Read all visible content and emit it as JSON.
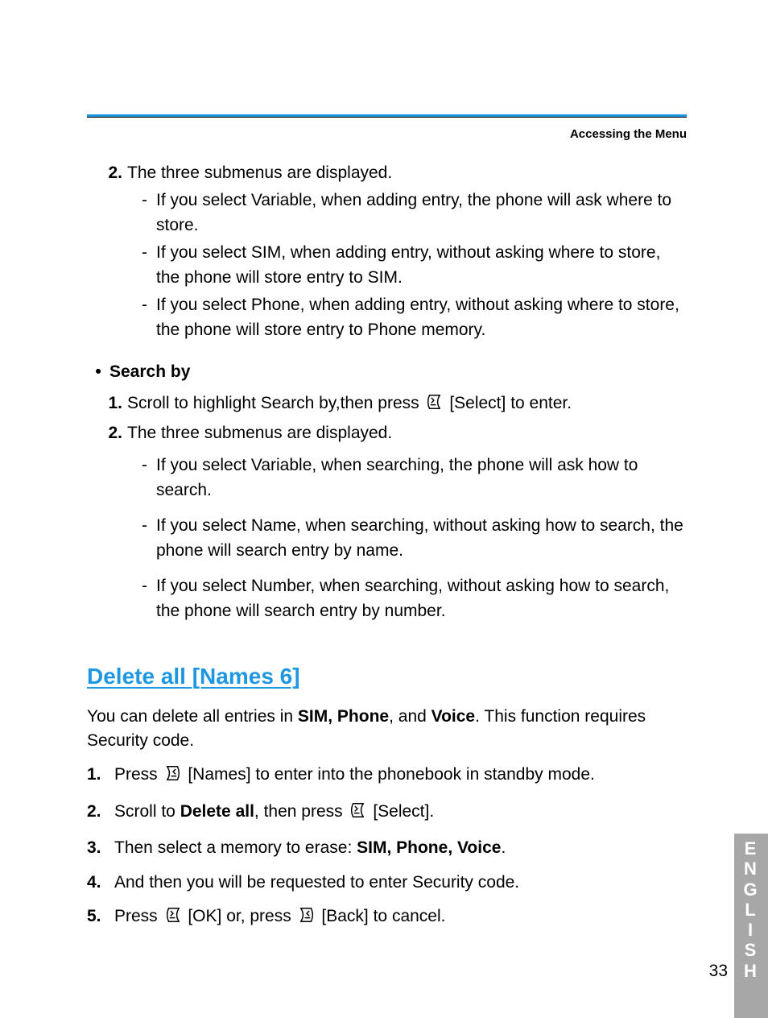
{
  "header": {
    "section": "Accessing the Menu"
  },
  "top": {
    "item2_num": "2.",
    "item2_text": "The three submenus are displayed.",
    "bullets": [
      "If you select Variable, when adding entry, the phone will ask where to store.",
      "If you select SIM, when adding entry, without asking where to store, the phone will store entry to SIM.",
      "If you select Phone, when adding entry, without asking where to store, the phone will store entry to Phone memory."
    ]
  },
  "search": {
    "title": "Search by",
    "step1_num": "1.",
    "step1_pre": "Scroll to highlight Search by,then press ",
    "step1_post": " [Select] to enter.",
    "step2_num": "2.",
    "step2_text": "The three submenus are displayed.",
    "bullets": [
      "If you select Variable, when searching, the phone will ask how to search.",
      "If you select Name, when searching, without asking how to search, the phone will search entry by name.",
      "If you select Number, when searching, without asking how to search, the phone will search entry by number."
    ]
  },
  "delete": {
    "heading": "Delete all [Names 6]",
    "intro_pre": "You can delete all entries in ",
    "intro_bold1": "SIM, Phone",
    "intro_mid": ", and ",
    "intro_bold2": "Voice",
    "intro_post": ". This function requires Security code.",
    "steps": {
      "s1_num": "1.",
      "s1_pre": "Press ",
      "s1_post": " [Names] to enter into the phonebook in standby mode.",
      "s2_num": "2.",
      "s2_pre": "Scroll to ",
      "s2_bold": "Delete all",
      "s2_mid": ", then press ",
      "s2_post": " [Select].",
      "s3_num": "3.",
      "s3_pre": "Then select a memory to erase: ",
      "s3_bold": "SIM, Phone, Voice",
      "s3_post": ".",
      "s4_num": "4.",
      "s4_text": "And then you will be requested to enter Security code.",
      "s5_num": "5.",
      "s5_pre": "Press ",
      "s5_mid": " [OK] or, press ",
      "s5_post": " [Back] to cancel."
    }
  },
  "side": {
    "letters": [
      "E",
      "N",
      "G",
      "L",
      "I",
      "S",
      "H"
    ]
  },
  "page_number": "33"
}
